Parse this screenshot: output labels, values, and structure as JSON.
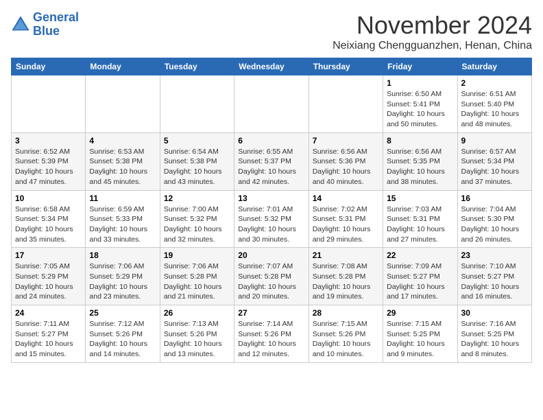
{
  "header": {
    "logo_line1": "General",
    "logo_line2": "Blue",
    "month": "November 2024",
    "location": "Neixiang Chengguanzhen, Henan, China"
  },
  "days_of_week": [
    "Sunday",
    "Monday",
    "Tuesday",
    "Wednesday",
    "Thursday",
    "Friday",
    "Saturday"
  ],
  "weeks": [
    [
      {
        "day": "",
        "info": ""
      },
      {
        "day": "",
        "info": ""
      },
      {
        "day": "",
        "info": ""
      },
      {
        "day": "",
        "info": ""
      },
      {
        "day": "",
        "info": ""
      },
      {
        "day": "1",
        "info": "Sunrise: 6:50 AM\nSunset: 5:41 PM\nDaylight: 10 hours and 50 minutes."
      },
      {
        "day": "2",
        "info": "Sunrise: 6:51 AM\nSunset: 5:40 PM\nDaylight: 10 hours and 48 minutes."
      }
    ],
    [
      {
        "day": "3",
        "info": "Sunrise: 6:52 AM\nSunset: 5:39 PM\nDaylight: 10 hours and 47 minutes."
      },
      {
        "day": "4",
        "info": "Sunrise: 6:53 AM\nSunset: 5:38 PM\nDaylight: 10 hours and 45 minutes."
      },
      {
        "day": "5",
        "info": "Sunrise: 6:54 AM\nSunset: 5:38 PM\nDaylight: 10 hours and 43 minutes."
      },
      {
        "day": "6",
        "info": "Sunrise: 6:55 AM\nSunset: 5:37 PM\nDaylight: 10 hours and 42 minutes."
      },
      {
        "day": "7",
        "info": "Sunrise: 6:56 AM\nSunset: 5:36 PM\nDaylight: 10 hours and 40 minutes."
      },
      {
        "day": "8",
        "info": "Sunrise: 6:56 AM\nSunset: 5:35 PM\nDaylight: 10 hours and 38 minutes."
      },
      {
        "day": "9",
        "info": "Sunrise: 6:57 AM\nSunset: 5:34 PM\nDaylight: 10 hours and 37 minutes."
      }
    ],
    [
      {
        "day": "10",
        "info": "Sunrise: 6:58 AM\nSunset: 5:34 PM\nDaylight: 10 hours and 35 minutes."
      },
      {
        "day": "11",
        "info": "Sunrise: 6:59 AM\nSunset: 5:33 PM\nDaylight: 10 hours and 33 minutes."
      },
      {
        "day": "12",
        "info": "Sunrise: 7:00 AM\nSunset: 5:32 PM\nDaylight: 10 hours and 32 minutes."
      },
      {
        "day": "13",
        "info": "Sunrise: 7:01 AM\nSunset: 5:32 PM\nDaylight: 10 hours and 30 minutes."
      },
      {
        "day": "14",
        "info": "Sunrise: 7:02 AM\nSunset: 5:31 PM\nDaylight: 10 hours and 29 minutes."
      },
      {
        "day": "15",
        "info": "Sunrise: 7:03 AM\nSunset: 5:31 PM\nDaylight: 10 hours and 27 minutes."
      },
      {
        "day": "16",
        "info": "Sunrise: 7:04 AM\nSunset: 5:30 PM\nDaylight: 10 hours and 26 minutes."
      }
    ],
    [
      {
        "day": "17",
        "info": "Sunrise: 7:05 AM\nSunset: 5:29 PM\nDaylight: 10 hours and 24 minutes."
      },
      {
        "day": "18",
        "info": "Sunrise: 7:06 AM\nSunset: 5:29 PM\nDaylight: 10 hours and 23 minutes."
      },
      {
        "day": "19",
        "info": "Sunrise: 7:06 AM\nSunset: 5:28 PM\nDaylight: 10 hours and 21 minutes."
      },
      {
        "day": "20",
        "info": "Sunrise: 7:07 AM\nSunset: 5:28 PM\nDaylight: 10 hours and 20 minutes."
      },
      {
        "day": "21",
        "info": "Sunrise: 7:08 AM\nSunset: 5:28 PM\nDaylight: 10 hours and 19 minutes."
      },
      {
        "day": "22",
        "info": "Sunrise: 7:09 AM\nSunset: 5:27 PM\nDaylight: 10 hours and 17 minutes."
      },
      {
        "day": "23",
        "info": "Sunrise: 7:10 AM\nSunset: 5:27 PM\nDaylight: 10 hours and 16 minutes."
      }
    ],
    [
      {
        "day": "24",
        "info": "Sunrise: 7:11 AM\nSunset: 5:27 PM\nDaylight: 10 hours and 15 minutes."
      },
      {
        "day": "25",
        "info": "Sunrise: 7:12 AM\nSunset: 5:26 PM\nDaylight: 10 hours and 14 minutes."
      },
      {
        "day": "26",
        "info": "Sunrise: 7:13 AM\nSunset: 5:26 PM\nDaylight: 10 hours and 13 minutes."
      },
      {
        "day": "27",
        "info": "Sunrise: 7:14 AM\nSunset: 5:26 PM\nDaylight: 10 hours and 12 minutes."
      },
      {
        "day": "28",
        "info": "Sunrise: 7:15 AM\nSunset: 5:26 PM\nDaylight: 10 hours and 10 minutes."
      },
      {
        "day": "29",
        "info": "Sunrise: 7:15 AM\nSunset: 5:25 PM\nDaylight: 10 hours and 9 minutes."
      },
      {
        "day": "30",
        "info": "Sunrise: 7:16 AM\nSunset: 5:25 PM\nDaylight: 10 hours and 8 minutes."
      }
    ]
  ]
}
